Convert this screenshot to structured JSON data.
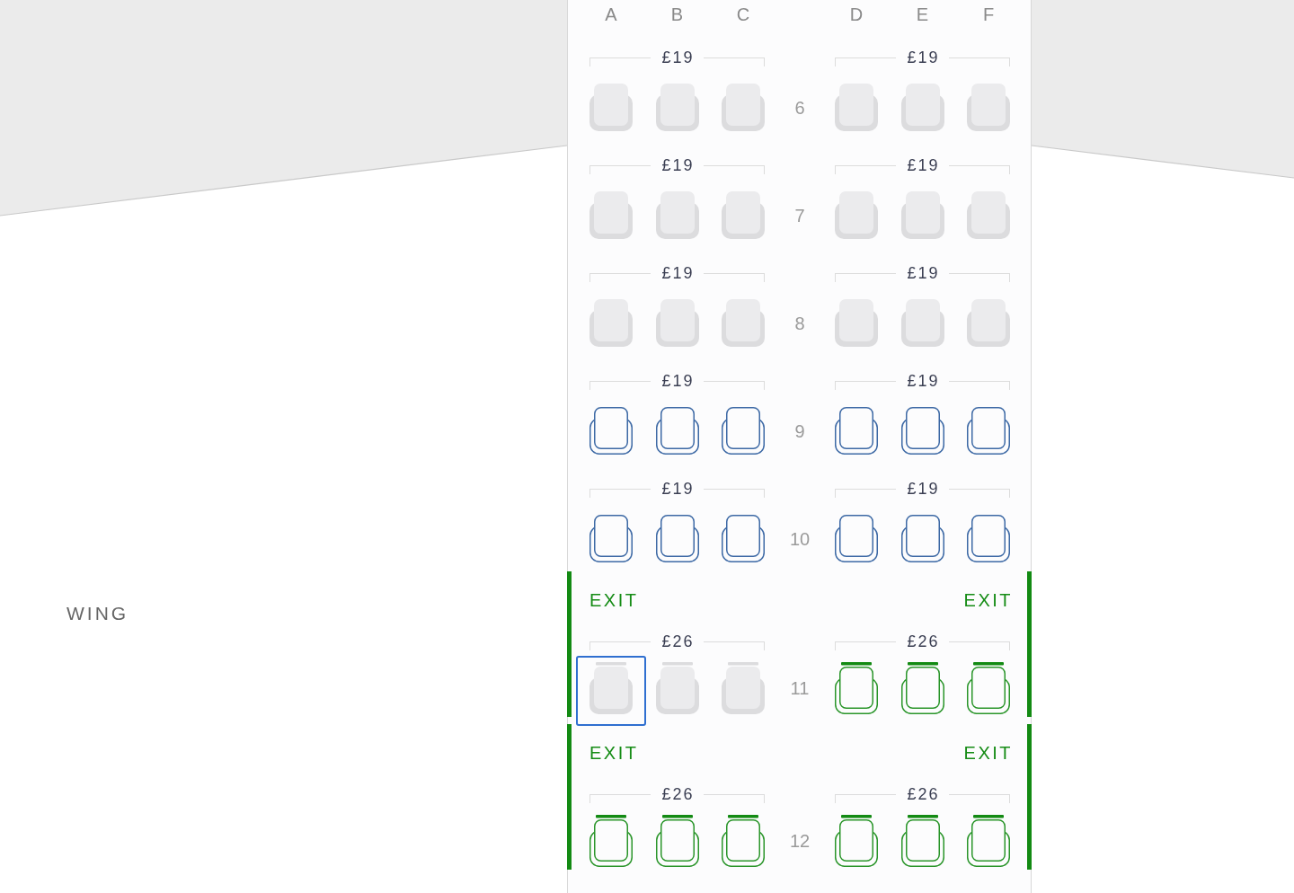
{
  "wing_label": "WING",
  "columns": {
    "left": [
      "A",
      "B",
      "C"
    ],
    "right": [
      "D",
      "E",
      "F"
    ]
  },
  "rows": [
    {
      "number": "6",
      "kind": "standard",
      "left": {
        "price": "£19",
        "seats": [
          {
            "available": false,
            "selected": false
          },
          {
            "available": false,
            "selected": false
          },
          {
            "available": false,
            "selected": false
          }
        ]
      },
      "right": {
        "price": "£19",
        "seats": [
          {
            "available": false,
            "selected": false
          },
          {
            "available": false,
            "selected": false
          },
          {
            "available": false,
            "selected": false
          }
        ]
      }
    },
    {
      "number": "7",
      "kind": "standard",
      "left": {
        "price": "£19",
        "seats": [
          {
            "available": false,
            "selected": false
          },
          {
            "available": false,
            "selected": false
          },
          {
            "available": false,
            "selected": false
          }
        ]
      },
      "right": {
        "price": "£19",
        "seats": [
          {
            "available": false,
            "selected": false
          },
          {
            "available": false,
            "selected": false
          },
          {
            "available": false,
            "selected": false
          }
        ]
      }
    },
    {
      "number": "8",
      "kind": "standard",
      "left": {
        "price": "£19",
        "seats": [
          {
            "available": false,
            "selected": false
          },
          {
            "available": false,
            "selected": false
          },
          {
            "available": false,
            "selected": false
          }
        ]
      },
      "right": {
        "price": "£19",
        "seats": [
          {
            "available": false,
            "selected": false
          },
          {
            "available": false,
            "selected": false
          },
          {
            "available": false,
            "selected": false
          }
        ]
      }
    },
    {
      "number": "9",
      "kind": "standard",
      "left": {
        "price": "£19",
        "seats": [
          {
            "available": true,
            "selected": false
          },
          {
            "available": true,
            "selected": false
          },
          {
            "available": true,
            "selected": false
          }
        ]
      },
      "right": {
        "price": "£19",
        "seats": [
          {
            "available": true,
            "selected": false
          },
          {
            "available": true,
            "selected": false
          },
          {
            "available": true,
            "selected": false
          }
        ]
      }
    },
    {
      "number": "10",
      "kind": "standard",
      "left": {
        "price": "£19",
        "seats": [
          {
            "available": true,
            "selected": false
          },
          {
            "available": true,
            "selected": false
          },
          {
            "available": true,
            "selected": false
          }
        ]
      },
      "right": {
        "price": "£19",
        "seats": [
          {
            "available": true,
            "selected": false
          },
          {
            "available": true,
            "selected": false
          },
          {
            "available": true,
            "selected": false
          }
        ]
      }
    },
    {
      "number": "11",
      "kind": "extra_legroom",
      "exit_labels": {
        "left": "EXIT",
        "right": "EXIT"
      },
      "left": {
        "price": "£26",
        "seats": [
          {
            "available": false,
            "selected": true
          },
          {
            "available": false,
            "selected": false
          },
          {
            "available": false,
            "selected": false
          }
        ]
      },
      "right": {
        "price": "£26",
        "seats": [
          {
            "available": true,
            "selected": false
          },
          {
            "available": true,
            "selected": false
          },
          {
            "available": true,
            "selected": false
          }
        ]
      }
    },
    {
      "number": "12",
      "kind": "extra_legroom",
      "exit_labels": {
        "left": "EXIT",
        "right": "EXIT"
      },
      "left": {
        "price": "£26",
        "seats": [
          {
            "available": true,
            "selected": false
          },
          {
            "available": true,
            "selected": false
          },
          {
            "available": true,
            "selected": false
          }
        ]
      },
      "right": {
        "price": "£26",
        "seats": [
          {
            "available": true,
            "selected": false
          },
          {
            "available": true,
            "selected": false
          },
          {
            "available": true,
            "selected": false
          }
        ]
      }
    }
  ]
}
